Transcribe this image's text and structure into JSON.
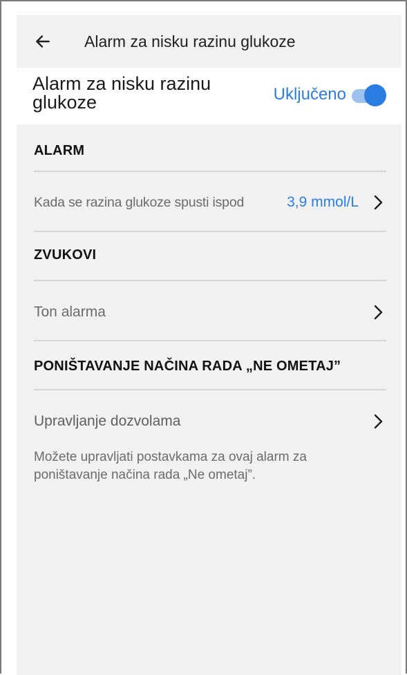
{
  "appbar": {
    "title": "Alarm za nisku razinu glukoze",
    "back_icon": "arrow-left-icon"
  },
  "master_switch": {
    "label": "Alarm za nisku razinu glukoze",
    "status": "Uključeno",
    "on": true
  },
  "sections": {
    "alarm": {
      "header": "ALARM",
      "row_label": "Kada se razina glukoze spusti ispod",
      "row_value": "3,9 mmol/L"
    },
    "sounds": {
      "header": "ZVUKOVI",
      "row_label": "Ton alarma"
    },
    "dnd_override": {
      "header": "PONIŠTAVANJE NAČINA RADA „NE OMETAJ”",
      "row_label": "Upravljanje dozvolama",
      "help_text": "Možete upravljati postavkama za ovaj alarm za poništavanje načina rada „Ne ometaj”."
    }
  },
  "colors": {
    "accent": "#2b7de1",
    "accent_light": "#9dc2f0",
    "background": "#f1f1f1",
    "divider": "#d6d6d6"
  },
  "icons": {
    "chevron": "chevron-right-icon"
  }
}
